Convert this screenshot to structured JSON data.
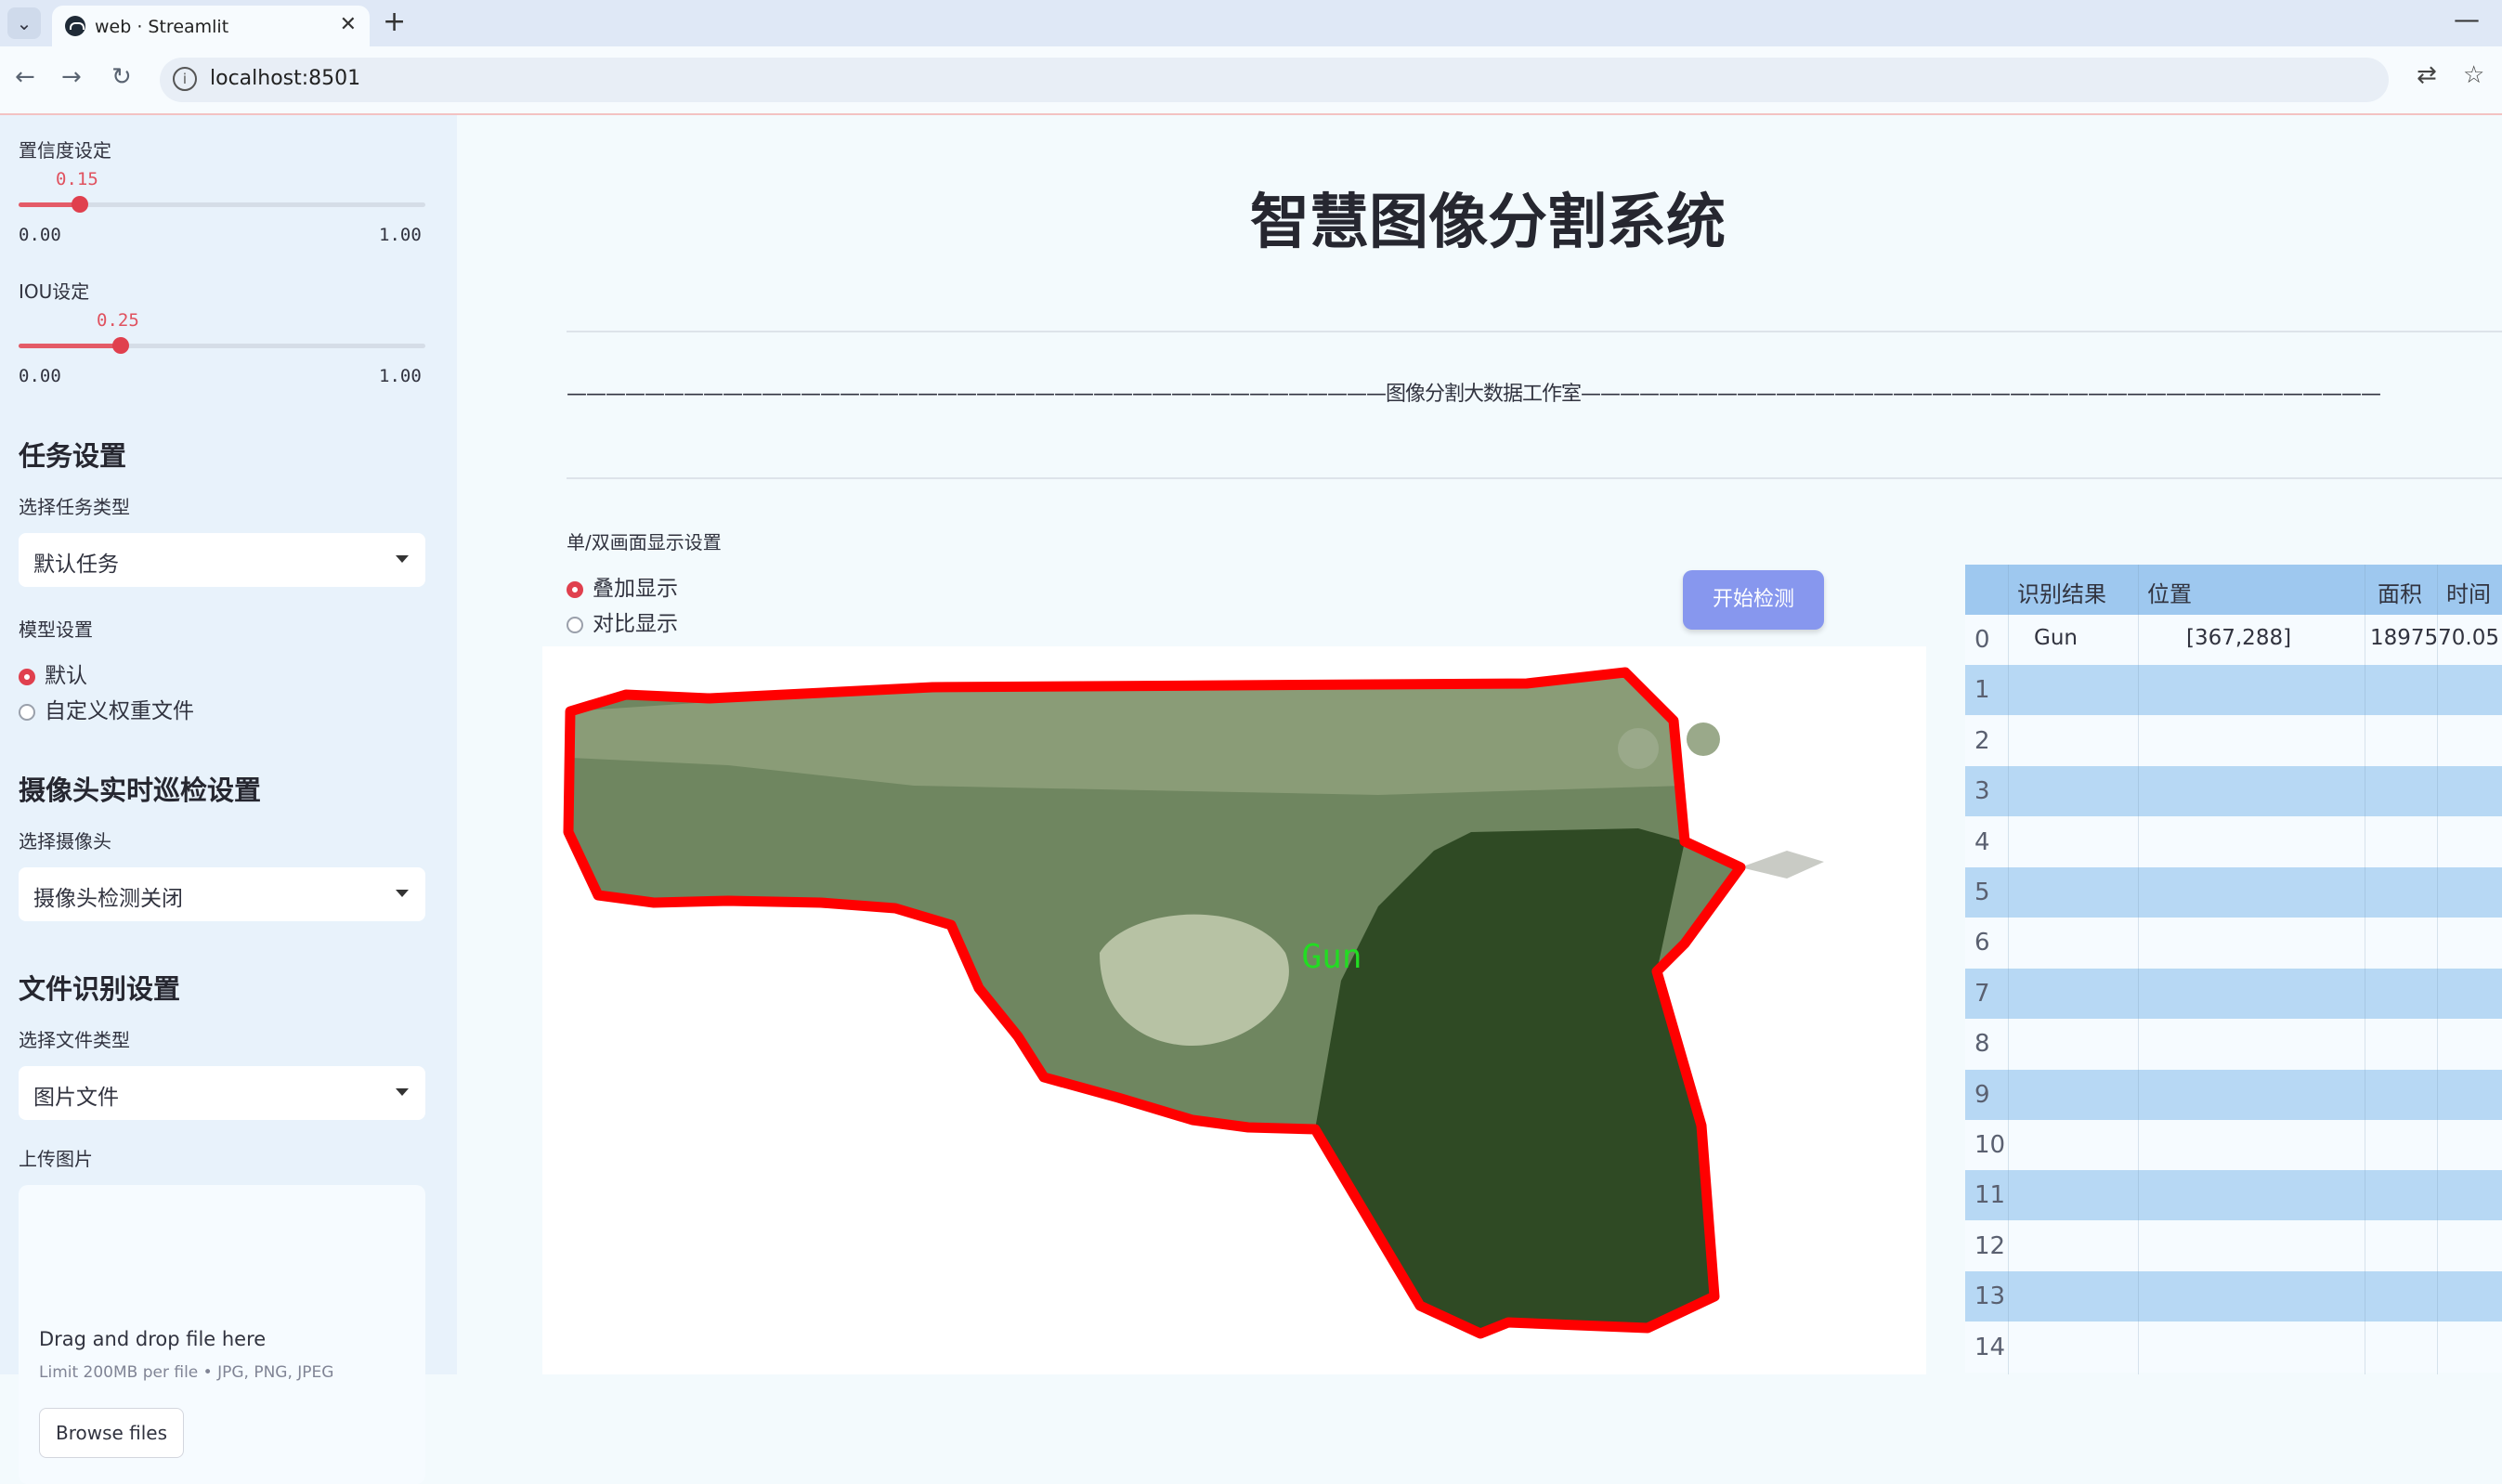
{
  "browser": {
    "tab_title": "web · Streamlit",
    "url": "localhost:8501"
  },
  "sidebar": {
    "confidence": {
      "label": "置信度设定",
      "value": "0.15",
      "min": "0.00",
      "max": "1.00",
      "fraction": 0.15
    },
    "iou": {
      "label": "IOU设定",
      "value": "0.25",
      "min": "0.00",
      "max": "1.00",
      "fraction": 0.25
    },
    "task_section": {
      "title": "任务设置",
      "select_label": "选择任务类型",
      "selected": "默认任务"
    },
    "model": {
      "label": "模型设置",
      "options": [
        "默认",
        "自定义权重文件"
      ],
      "selected_index": 0
    },
    "camera_section": {
      "title": "摄像头实时巡检设置",
      "select_label": "选择摄像头",
      "selected": "摄像头检测关闭"
    },
    "file_section": {
      "title": "文件识别设置",
      "select_label": "选择文件类型",
      "selected": "图片文件"
    },
    "upload": {
      "label": "上传图片",
      "drop_text": "Drag and drop file here",
      "limit_text": "Limit 200MB per file • JPG, PNG, JPEG",
      "browse_label": "Browse files"
    }
  },
  "main": {
    "title": "智慧图像分割系统",
    "subtitle_line": "——————————————————————————————————————————图像分割大数据工作室—————————————————————————————————————————",
    "display_label": "单/双画面显示设置",
    "display_options": [
      "叠加显示",
      "对比显示"
    ],
    "display_selected_index": 0,
    "start_button": "开始检测",
    "detection_label": "Gun"
  },
  "results_table": {
    "columns": [
      "识别结果",
      "位置",
      "面积",
      "时间"
    ],
    "rows": [
      {
        "index": "0",
        "result": "Gun",
        "position": "[367,288]",
        "area": "1897570.05",
        "time": ""
      },
      {
        "index": "1",
        "result": "",
        "position": "",
        "area": "",
        "time": ""
      },
      {
        "index": "2",
        "result": "",
        "position": "",
        "area": "",
        "time": ""
      },
      {
        "index": "3",
        "result": "",
        "position": "",
        "area": "",
        "time": ""
      },
      {
        "index": "4",
        "result": "",
        "position": "",
        "area": "",
        "time": ""
      },
      {
        "index": "5",
        "result": "",
        "position": "",
        "area": "",
        "time": ""
      },
      {
        "index": "6",
        "result": "",
        "position": "",
        "area": "",
        "time": ""
      },
      {
        "index": "7",
        "result": "",
        "position": "",
        "area": "",
        "time": ""
      },
      {
        "index": "8",
        "result": "",
        "position": "",
        "area": "",
        "time": ""
      },
      {
        "index": "9",
        "result": "",
        "position": "",
        "area": "",
        "time": ""
      },
      {
        "index": "10",
        "result": "",
        "position": "",
        "area": "",
        "time": ""
      },
      {
        "index": "11",
        "result": "",
        "position": "",
        "area": "",
        "time": ""
      },
      {
        "index": "12",
        "result": "",
        "position": "",
        "area": "",
        "time": ""
      },
      {
        "index": "13",
        "result": "",
        "position": "",
        "area": "",
        "time": ""
      },
      {
        "index": "14",
        "result": "",
        "position": "",
        "area": "",
        "time": ""
      }
    ]
  },
  "colors": {
    "accent": "#e0404e",
    "button": "#8797ee",
    "mask_outline": "#ff0000",
    "label_green": "#22dd22"
  }
}
